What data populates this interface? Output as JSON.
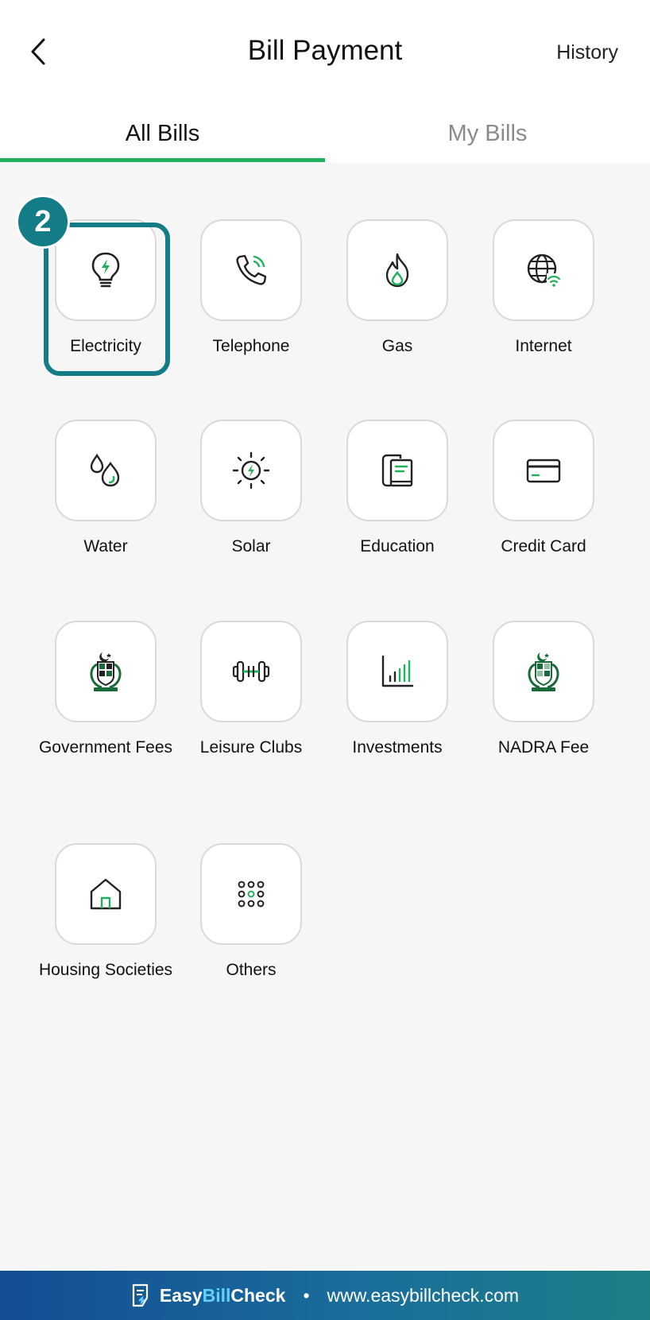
{
  "header": {
    "title": "Bill Payment",
    "history_label": "History"
  },
  "tabs": [
    {
      "label": "All Bills",
      "active": true
    },
    {
      "label": "My Bills",
      "active": false
    }
  ],
  "categories": [
    {
      "label": "Electricity",
      "icon": "lightbulb-bolt-icon"
    },
    {
      "label": "Telephone",
      "icon": "phone-signal-icon"
    },
    {
      "label": "Gas",
      "icon": "flame-icon"
    },
    {
      "label": "Internet",
      "icon": "globe-wifi-icon"
    },
    {
      "label": "Water",
      "icon": "water-drops-icon"
    },
    {
      "label": "Solar",
      "icon": "sun-bolt-icon"
    },
    {
      "label": "Education",
      "icon": "books-icon"
    },
    {
      "label": "Credit Card",
      "icon": "credit-card-icon"
    },
    {
      "label": "Government Fees",
      "icon": "state-emblem-icon"
    },
    {
      "label": "Leisure Clubs",
      "icon": "dumbbell-icon"
    },
    {
      "label": "Investments",
      "icon": "bar-chart-icon"
    },
    {
      "label": "NADRA Fee",
      "icon": "state-emblem-icon"
    },
    {
      "label": "Housing Societies",
      "icon": "house-icon"
    },
    {
      "label": "Others",
      "icon": "dots-grid-icon"
    }
  ],
  "tutorial": {
    "step_number": "2"
  },
  "footer": {
    "brand_easy": "Easy",
    "brand_bill": "Bill",
    "brand_check": "Check",
    "separator": "•",
    "website": "www.easybillcheck.com"
  },
  "colors": {
    "accent_green": "#1fb15b",
    "highlight_teal": "#137c86",
    "footer_blue": "#134d93"
  }
}
